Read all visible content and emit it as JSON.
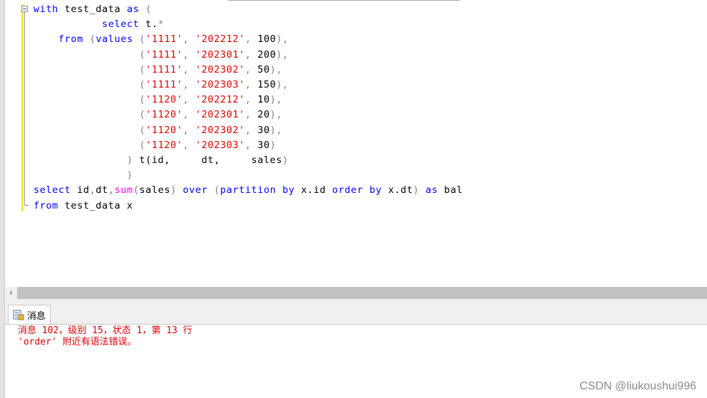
{
  "editor": {
    "code_lines": [
      [
        {
          "t": "with",
          "c": "kw"
        },
        {
          "t": " test_data ",
          "c": "tx"
        },
        {
          "t": "as",
          "c": "kw"
        },
        {
          "t": " (",
          "c": "op"
        }
      ],
      [
        {
          "t": "           ",
          "c": "tx"
        },
        {
          "t": "select",
          "c": "kw"
        },
        {
          "t": " t.",
          "c": "tx"
        },
        {
          "t": "*",
          "c": "op"
        }
      ],
      [
        {
          "t": "    ",
          "c": "tx"
        },
        {
          "t": "from",
          "c": "kw"
        },
        {
          "t": " (",
          "c": "op"
        },
        {
          "t": "values",
          "c": "kw"
        },
        {
          "t": " (",
          "c": "op"
        },
        {
          "t": "'1111'",
          "c": "st"
        },
        {
          "t": ", ",
          "c": "op"
        },
        {
          "t": "'202212'",
          "c": "st"
        },
        {
          "t": ", ",
          "c": "op"
        },
        {
          "t": "100",
          "c": "tx"
        },
        {
          "t": "),",
          "c": "op"
        }
      ],
      [
        {
          "t": "                 (",
          "c": "op"
        },
        {
          "t": "'1111'",
          "c": "st"
        },
        {
          "t": ", ",
          "c": "op"
        },
        {
          "t": "'202301'",
          "c": "st"
        },
        {
          "t": ", ",
          "c": "op"
        },
        {
          "t": "200",
          "c": "tx"
        },
        {
          "t": "),",
          "c": "op"
        }
      ],
      [
        {
          "t": "                 (",
          "c": "op"
        },
        {
          "t": "'1111'",
          "c": "st"
        },
        {
          "t": ", ",
          "c": "op"
        },
        {
          "t": "'202302'",
          "c": "st"
        },
        {
          "t": ", ",
          "c": "op"
        },
        {
          "t": "50",
          "c": "tx"
        },
        {
          "t": "),",
          "c": "op"
        }
      ],
      [
        {
          "t": "                 (",
          "c": "op"
        },
        {
          "t": "'1111'",
          "c": "st"
        },
        {
          "t": ", ",
          "c": "op"
        },
        {
          "t": "'202303'",
          "c": "st"
        },
        {
          "t": ", ",
          "c": "op"
        },
        {
          "t": "150",
          "c": "tx"
        },
        {
          "t": "),",
          "c": "op"
        }
      ],
      [
        {
          "t": "                 (",
          "c": "op"
        },
        {
          "t": "'1120'",
          "c": "st"
        },
        {
          "t": ", ",
          "c": "op"
        },
        {
          "t": "'202212'",
          "c": "st"
        },
        {
          "t": ", ",
          "c": "op"
        },
        {
          "t": "10",
          "c": "tx"
        },
        {
          "t": "),",
          "c": "op"
        }
      ],
      [
        {
          "t": "                 (",
          "c": "op"
        },
        {
          "t": "'1120'",
          "c": "st"
        },
        {
          "t": ", ",
          "c": "op"
        },
        {
          "t": "'202301'",
          "c": "st"
        },
        {
          "t": ", ",
          "c": "op"
        },
        {
          "t": "20",
          "c": "tx"
        },
        {
          "t": "),",
          "c": "op"
        }
      ],
      [
        {
          "t": "                 (",
          "c": "op"
        },
        {
          "t": "'1120'",
          "c": "st"
        },
        {
          "t": ", ",
          "c": "op"
        },
        {
          "t": "'202302'",
          "c": "st"
        },
        {
          "t": ", ",
          "c": "op"
        },
        {
          "t": "30",
          "c": "tx"
        },
        {
          "t": "),",
          "c": "op"
        }
      ],
      [
        {
          "t": "                 (",
          "c": "op"
        },
        {
          "t": "'1120'",
          "c": "st"
        },
        {
          "t": ", ",
          "c": "op"
        },
        {
          "t": "'202303'",
          "c": "st"
        },
        {
          "t": ", ",
          "c": "op"
        },
        {
          "t": "30",
          "c": "tx"
        },
        {
          "t": ")",
          "c": "op"
        }
      ],
      [
        {
          "t": "               ) ",
          "c": "op"
        },
        {
          "t": "t(id,     dt,     sales",
          "c": "tx"
        },
        {
          "t": ")",
          "c": "op"
        }
      ],
      [
        {
          "t": "               )",
          "c": "op"
        }
      ],
      [
        {
          "t": "select",
          "c": "kw"
        },
        {
          "t": " id",
          "c": "tx"
        },
        {
          "t": ",",
          "c": "op"
        },
        {
          "t": "dt",
          "c": "tx"
        },
        {
          "t": ",",
          "c": "op"
        },
        {
          "t": "sum",
          "c": "fn"
        },
        {
          "t": "(",
          "c": "op"
        },
        {
          "t": "sales",
          "c": "tx"
        },
        {
          "t": ") ",
          "c": "op"
        },
        {
          "t": "over",
          "c": "kw"
        },
        {
          "t": " (",
          "c": "op"
        },
        {
          "t": "partition by",
          "c": "kw"
        },
        {
          "t": " x.id ",
          "c": "tx"
        },
        {
          "t": "order by",
          "c": "kw"
        },
        {
          "t": " x.dt",
          "c": "tx"
        },
        {
          "t": ") ",
          "c": "op"
        },
        {
          "t": "as",
          "c": "kw"
        },
        {
          "t": " bal",
          "c": "tx"
        }
      ],
      [
        {
          "t": "from",
          "c": "kw"
        },
        {
          "t": " test_data x",
          "c": "tx"
        }
      ]
    ]
  },
  "scrollbar": {
    "left_arrow": "‹"
  },
  "results": {
    "tab_label": "消息",
    "messages": [
      "消息 102，级别 15，状态 1，第 13 行",
      "'order' 附近有语法错误。"
    ]
  },
  "watermark": "CSDN @liukoushui996",
  "colors": {
    "keyword": "#0000ff",
    "string": "#e00000",
    "function": "#ff00ff",
    "operator": "#808080",
    "error": "#e00000"
  }
}
